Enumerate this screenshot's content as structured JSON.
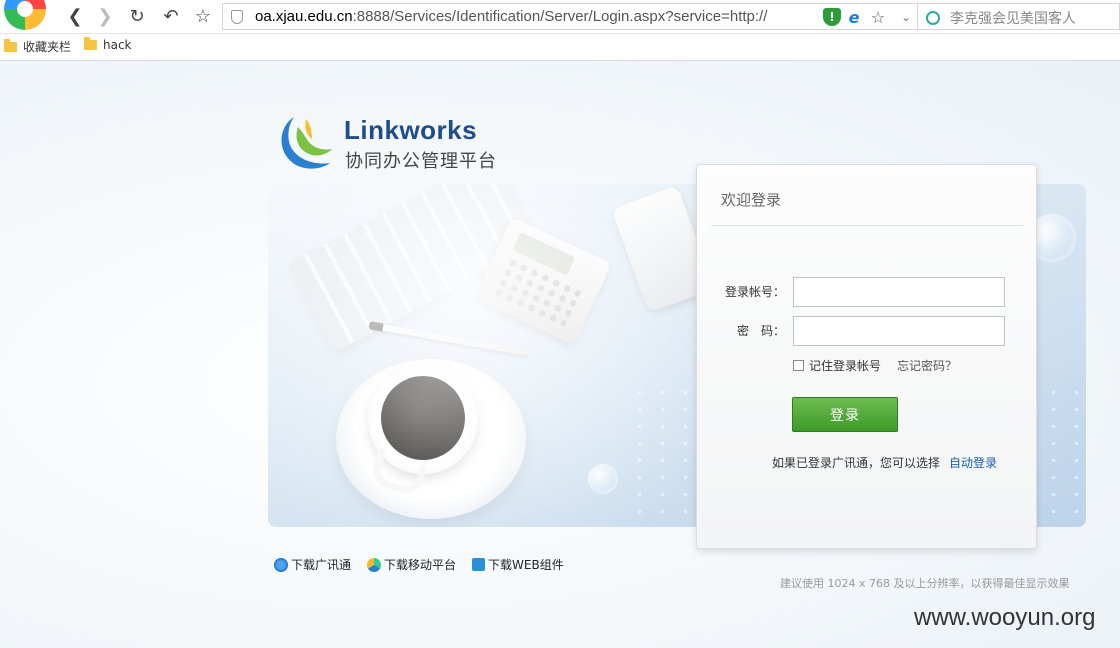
{
  "browser": {
    "url_host": "oa.xjau.edu.cn",
    "url_rest": ":8888/Services/Identification/Server/Login.aspx?service=http://",
    "search_placeholder": "李克强会见美国客人",
    "bookmarks": [
      {
        "label": "收藏夹栏",
        "icon": "folder-icon"
      },
      {
        "label": "hack",
        "icon": "folder-icon"
      }
    ]
  },
  "logo": {
    "name": "Linkworks",
    "subtitle": "协同办公管理平台"
  },
  "login": {
    "title": "欢迎登录",
    "account_label": "登录帐号：",
    "account_value": "",
    "password_label": "密　码：",
    "password_value": "",
    "remember_label": "记住登录帐号",
    "remember_checked": false,
    "forgot_label": "忘记密码？",
    "submit_label": "登录",
    "sso_text": "如果已登录广讯通，您可以选择",
    "sso_link": "自动登录"
  },
  "downloads": [
    {
      "label": "下载广讯通",
      "icon": "ie-download-icon"
    },
    {
      "label": "下载移动平台",
      "icon": "mobile-platform-icon"
    },
    {
      "label": "下载WEB组件",
      "icon": "web-component-icon"
    }
  ],
  "recommend_text": "建议使用 1024 x 768 及以上分辨率，以获得最佳显示效果",
  "watermark": "www.wooyun.org",
  "colors": {
    "brand_blue": "#1e4c8c",
    "login_green": "#4aa832",
    "link_blue": "#1a5fb4"
  }
}
